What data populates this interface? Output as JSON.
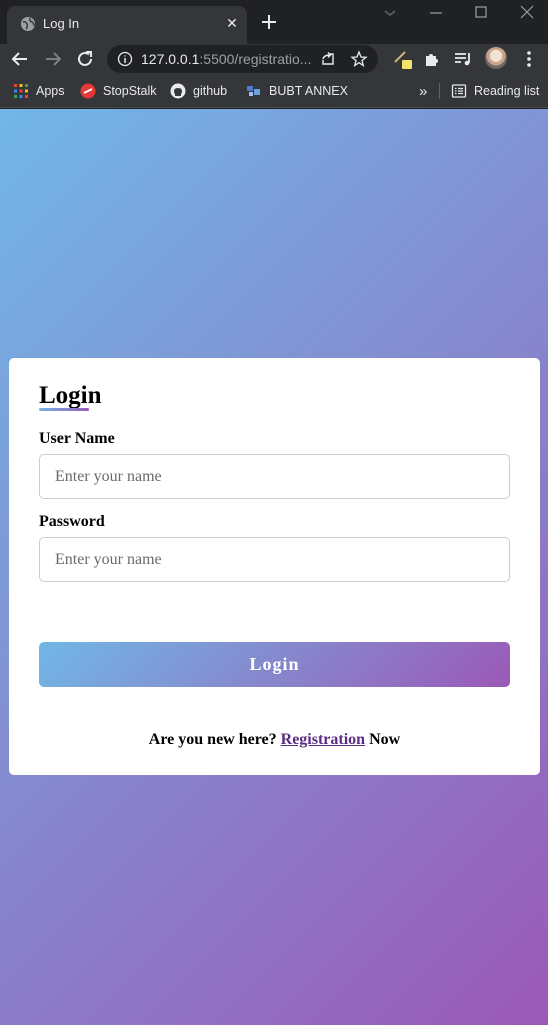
{
  "browser": {
    "tab": {
      "title": "Log In",
      "favicon": "globe-icon",
      "close": "✕"
    },
    "new_tab": "+",
    "omnibox": {
      "url_host": "127.0.0.1",
      "url_rest": ":5500/registratio..."
    },
    "bookmarks": [
      {
        "label": "Apps",
        "icon": "apps-grid-icon"
      },
      {
        "label": "StopStalk",
        "icon": "stopstalk-icon"
      },
      {
        "label": "github",
        "icon": "github-icon"
      },
      {
        "label": "BUBT ANNEX",
        "icon": "bubt-icon"
      }
    ],
    "overflow": "»",
    "reading_list": "Reading list"
  },
  "page": {
    "background_gradient": [
      "#71b7e6",
      "#9b59b6"
    ],
    "login_title": "Login",
    "username": {
      "label": "User Name",
      "placeholder": "Enter your name"
    },
    "password": {
      "label": "Password",
      "placeholder": "Enter your name"
    },
    "login_button": "Login",
    "signup": {
      "prefix": "Are you new here?",
      "link": "Registration",
      "suffix": "Now"
    }
  }
}
